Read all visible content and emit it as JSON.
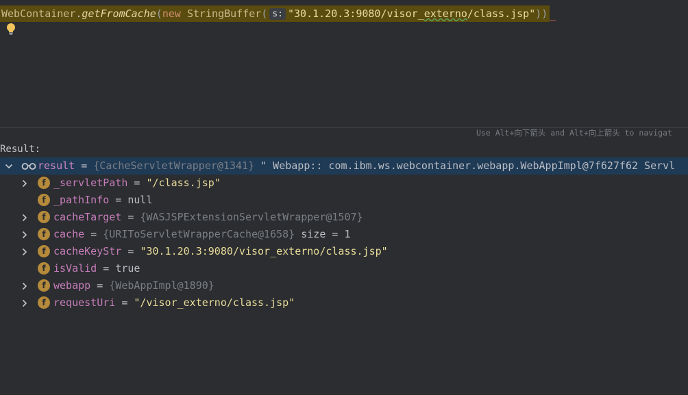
{
  "editor": {
    "expr": {
      "class_name": "WebContainer",
      "dot": ".",
      "method": "getFromCache",
      "open_paren": "(",
      "keyword_new": "new",
      "type_name": "StringBuffer",
      "inner_open": "(",
      "param_hint": "s:",
      "arg_value": "\"30.1.20.3:9080/visor_",
      "arg_value_typo": "externo",
      "arg_value_end": "/class.jsp\"",
      "close_parens": "))"
    },
    "hint": "Use Alt+向下箭头 and Alt+向上箭头 to navigat"
  },
  "result": {
    "label": "Result:",
    "root": {
      "name": "result",
      "eq": " = ",
      "ref": "{CacheServletWrapper@1341}",
      "value": " \" Webapp::  com.ibm.ws.webcontainer.webapp.WebAppImpl@7f627f62   Servl"
    },
    "children": [
      {
        "name": "_servletPath",
        "eq": " = ",
        "ref": "",
        "value": "\"/class.jsp\"",
        "value_type": "str",
        "expandable": true
      },
      {
        "name": "_pathInfo",
        "eq": " = ",
        "ref": "",
        "value": "null",
        "value_type": "plain",
        "expandable": false
      },
      {
        "name": "cacheTarget",
        "eq": " = ",
        "ref": "{WASJSPExtensionServletWrapper@1507}",
        "value": "",
        "value_type": "plain",
        "expandable": true
      },
      {
        "name": "cache",
        "eq": " = ",
        "ref": "{URIToServletWrapperCache@1658}",
        "value": "  size = 1",
        "value_type": "plain",
        "expandable": true
      },
      {
        "name": "cacheKeyStr",
        "eq": " = ",
        "ref": "",
        "value": "\"30.1.20.3:9080/visor_externo/class.jsp\"",
        "value_type": "str",
        "expandable": true
      },
      {
        "name": "isValid",
        "eq": " = ",
        "ref": "",
        "value": "true",
        "value_type": "plain",
        "expandable": false
      },
      {
        "name": "webapp",
        "eq": " = ",
        "ref": "{WebAppImpl@1890}",
        "value": "",
        "value_type": "plain",
        "expandable": true
      },
      {
        "name": "requestUri",
        "eq": " = ",
        "ref": "",
        "value": "\"/visor_externo/class.jsp\"",
        "value_type": "str",
        "expandable": true
      }
    ],
    "field_icon_letter": "f"
  },
  "colors": {
    "background": "#2b2d30",
    "selection": "#1f3a55",
    "expression_highlight": "#5a4c0f",
    "field_icon": "#b58a3a",
    "string": "#e9dc9a",
    "field_name": "#c77dbb"
  }
}
